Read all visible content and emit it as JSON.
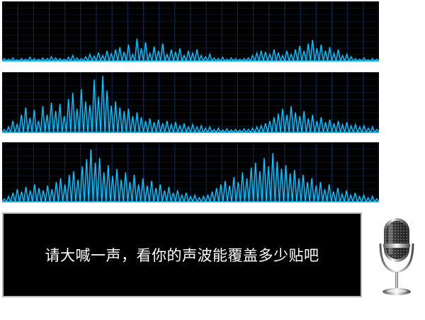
{
  "prompt": {
    "text": "请大喊一声，看你的声波能覆盖多少贴吧"
  },
  "colors": {
    "background": "#000000",
    "grid": "#0d3a66",
    "wave": "#19c8ff",
    "wave_glow": "#0a6fb0",
    "text": "#ffffff",
    "border": "#b9b9b9"
  },
  "icons": {
    "microphone": "microphone-icon"
  },
  "waveforms": [
    {
      "name": "waveform-1",
      "peaks": [
        0.05,
        0.04,
        0.06,
        0.03,
        0.05,
        0.04,
        0.07,
        0.05,
        0.04,
        0.06,
        0.05,
        0.08,
        0.06,
        0.05,
        0.04,
        0.07,
        0.1,
        0.06,
        0.05,
        0.08,
        0.12,
        0.09,
        0.15,
        0.1,
        0.18,
        0.13,
        0.2,
        0.24,
        0.16,
        0.28,
        0.12,
        0.38,
        0.22,
        0.32,
        0.14,
        0.25,
        0.18,
        0.3,
        0.12,
        0.2,
        0.16,
        0.22,
        0.1,
        0.18,
        0.14,
        0.2,
        0.1,
        0.08,
        0.12,
        0.06,
        0.05,
        0.07,
        0.04,
        0.06,
        0.05,
        0.04,
        0.05,
        0.06,
        0.1,
        0.14,
        0.18,
        0.16,
        0.12,
        0.2,
        0.15,
        0.1,
        0.18,
        0.12,
        0.2,
        0.26,
        0.18,
        0.3,
        0.36,
        0.22,
        0.28,
        0.18,
        0.24,
        0.14,
        0.2,
        0.1,
        0.12,
        0.08,
        0.05,
        0.04,
        0.06,
        0.03,
        0.05,
        0.04
      ]
    },
    {
      "name": "waveform-2",
      "peaks": [
        0.06,
        0.1,
        0.2,
        0.14,
        0.3,
        0.42,
        0.25,
        0.38,
        0.2,
        0.44,
        0.3,
        0.5,
        0.36,
        0.48,
        0.28,
        0.56,
        0.66,
        0.4,
        0.72,
        0.52,
        0.46,
        0.88,
        0.6,
        0.94,
        0.7,
        0.45,
        0.52,
        0.42,
        0.36,
        0.4,
        0.28,
        0.34,
        0.26,
        0.2,
        0.24,
        0.18,
        0.22,
        0.16,
        0.2,
        0.14,
        0.18,
        0.12,
        0.16,
        0.1,
        0.14,
        0.1,
        0.12,
        0.08,
        0.1,
        0.06,
        0.08,
        0.05,
        0.07,
        0.05,
        0.06,
        0.05,
        0.07,
        0.06,
        0.08,
        0.1,
        0.12,
        0.16,
        0.2,
        0.26,
        0.32,
        0.4,
        0.3,
        0.44,
        0.34,
        0.28,
        0.36,
        0.24,
        0.3,
        0.2,
        0.26,
        0.18,
        0.22,
        0.16,
        0.2,
        0.14,
        0.18,
        0.12,
        0.14,
        0.1,
        0.12,
        0.08,
        0.1,
        0.06
      ]
    },
    {
      "name": "waveform-3",
      "peaks": [
        0.06,
        0.1,
        0.16,
        0.22,
        0.18,
        0.26,
        0.2,
        0.3,
        0.24,
        0.2,
        0.28,
        0.22,
        0.34,
        0.4,
        0.3,
        0.46,
        0.52,
        0.38,
        0.6,
        0.72,
        0.88,
        0.66,
        0.74,
        0.5,
        0.62,
        0.44,
        0.56,
        0.38,
        0.5,
        0.34,
        0.46,
        0.3,
        0.4,
        0.28,
        0.36,
        0.24,
        0.3,
        0.2,
        0.26,
        0.16,
        0.2,
        0.12,
        0.16,
        0.1,
        0.12,
        0.08,
        0.1,
        0.12,
        0.18,
        0.24,
        0.3,
        0.36,
        0.28,
        0.42,
        0.34,
        0.5,
        0.4,
        0.58,
        0.66,
        0.52,
        0.74,
        0.6,
        0.82,
        0.68,
        0.56,
        0.62,
        0.48,
        0.54,
        0.4,
        0.46,
        0.34,
        0.4,
        0.28,
        0.34,
        0.22,
        0.3,
        0.18,
        0.24,
        0.14,
        0.2,
        0.12,
        0.16,
        0.1,
        0.12,
        0.08,
        0.1,
        0.06
      ]
    }
  ]
}
